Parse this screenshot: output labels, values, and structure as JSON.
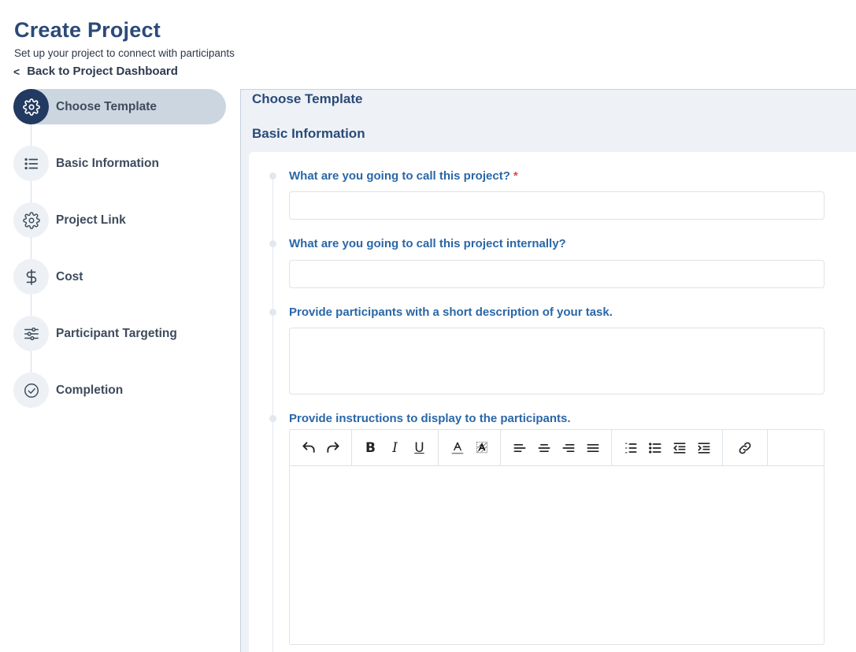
{
  "header": {
    "title": "Create Project",
    "subtitle": "Set up your project to connect with participants",
    "back_chevron": "<",
    "back_link": "Back to Project Dashboard"
  },
  "stepper": {
    "steps": [
      {
        "label": "Choose Template",
        "icon": "gear-icon",
        "active": true
      },
      {
        "label": "Basic Information",
        "icon": "list-icon",
        "active": false
      },
      {
        "label": "Project Link",
        "icon": "gear-icon",
        "active": false
      },
      {
        "label": "Cost",
        "icon": "dollar-icon",
        "active": false
      },
      {
        "label": "Participant Targeting",
        "icon": "sliders-icon",
        "active": false
      },
      {
        "label": "Completion",
        "icon": "check-circle-icon",
        "active": false
      }
    ]
  },
  "main": {
    "section_title_1": "Choose Template",
    "section_title_2": "Basic Information",
    "fields": {
      "project_name": {
        "label": "What are you going to call this project?",
        "required_mark": "*",
        "value": ""
      },
      "internal_name": {
        "label": "What are you going to call this project internally?",
        "value": ""
      },
      "short_description": {
        "label": "Provide participants with a short description of your task.",
        "value": ""
      },
      "instructions": {
        "label": "Provide instructions to display to the participants.",
        "value": ""
      }
    },
    "toolbar": {
      "bold": "B",
      "italic": "I",
      "underline": "U"
    }
  },
  "colors": {
    "brand_navy": "#223a61",
    "title_blue": "#2b4a78",
    "label_blue": "#2a67a8",
    "required_red": "#e04848",
    "active_step_bg": "#ccd6e0",
    "panel_bg": "#eef2f6"
  }
}
